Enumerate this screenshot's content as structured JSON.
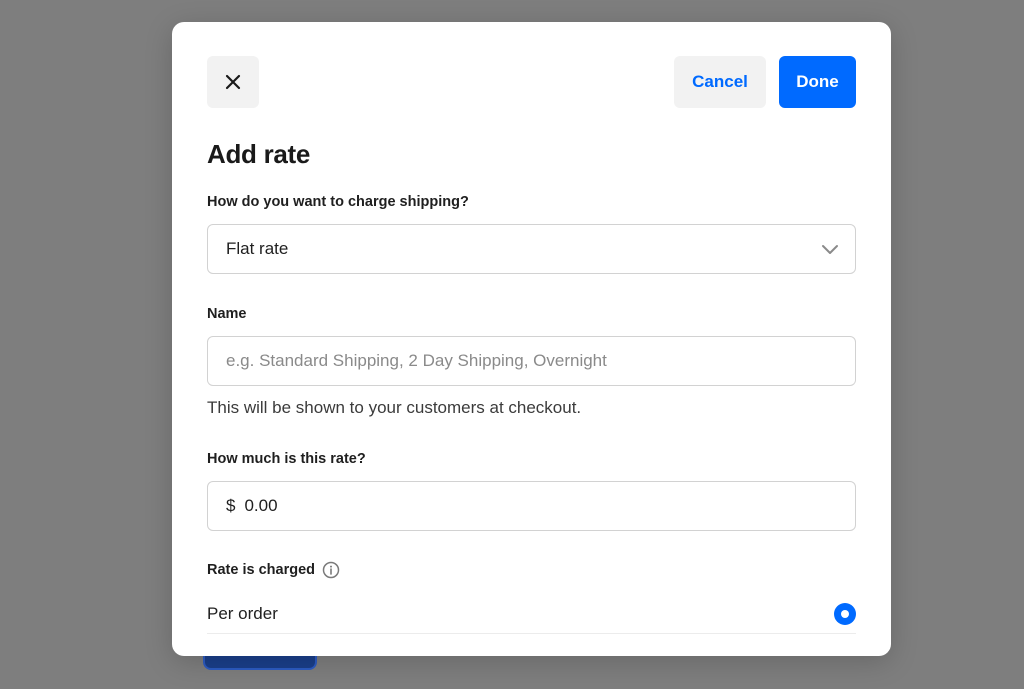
{
  "header": {
    "cancel_label": "Cancel",
    "done_label": "Done"
  },
  "title": "Add rate",
  "charge_method": {
    "label": "How do you want to charge shipping?",
    "selected": "Flat rate"
  },
  "name_field": {
    "label": "Name",
    "placeholder": "e.g. Standard Shipping, 2 Day Shipping, Overnight",
    "value": "",
    "helper": "This will be shown to your customers at checkout."
  },
  "rate_field": {
    "label": "How much is this rate?",
    "currency": "$",
    "value": "0.00"
  },
  "rate_charged": {
    "label": "Rate is charged",
    "options": [
      {
        "label": "Per order",
        "selected": true
      }
    ]
  },
  "icons": {
    "close": "close-icon",
    "chevron": "chevron-down-icon",
    "info": "info-icon"
  },
  "colors": {
    "accent": "#006aff",
    "overlay": "#7e7e7e",
    "secondary_button_bg": "#f2f2f2"
  }
}
